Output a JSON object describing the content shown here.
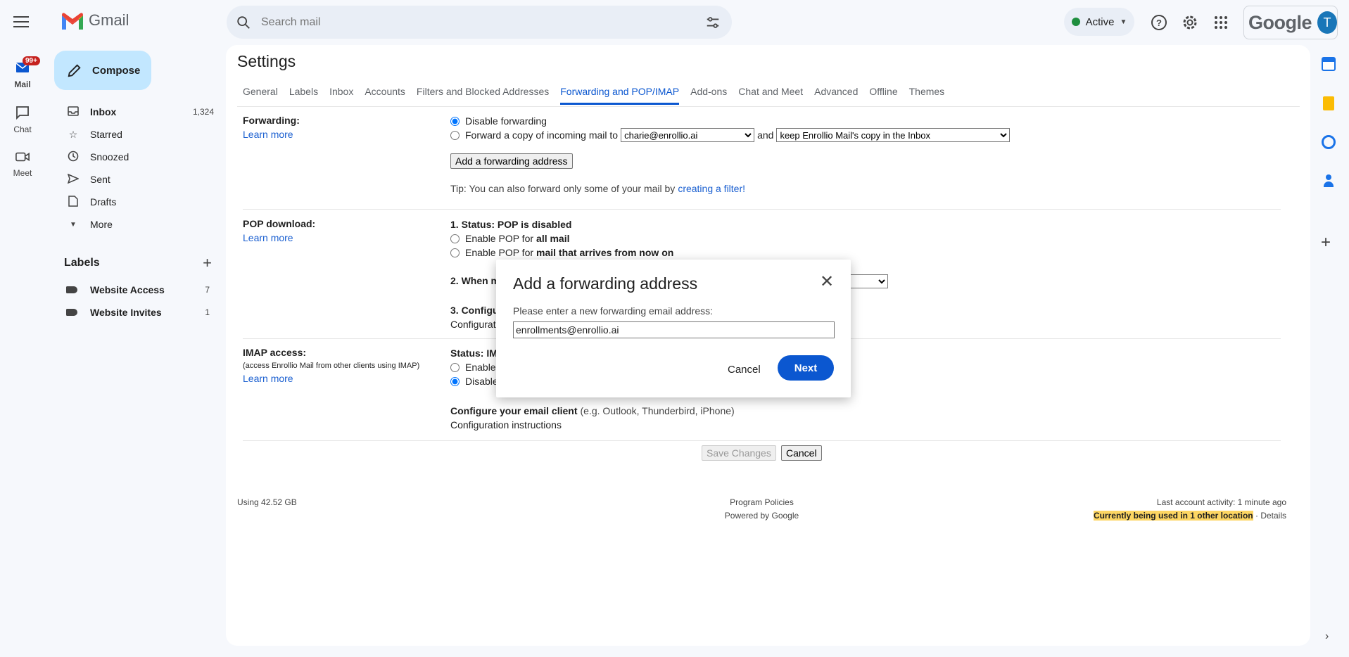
{
  "app": {
    "logo_text": "Gmail",
    "google_text": "Google",
    "avatar_letter": "T"
  },
  "search": {
    "placeholder": "Search mail"
  },
  "header": {
    "status_label": "Active"
  },
  "rail": {
    "mail_badge": "99+",
    "items": [
      {
        "label": "Mail"
      },
      {
        "label": "Chat"
      },
      {
        "label": "Meet"
      }
    ]
  },
  "compose_label": "Compose",
  "nav": {
    "items": [
      {
        "label": "Inbox",
        "count": "1,324"
      },
      {
        "label": "Starred"
      },
      {
        "label": "Snoozed"
      },
      {
        "label": "Sent"
      },
      {
        "label": "Drafts"
      },
      {
        "label": "More"
      }
    ]
  },
  "labels": {
    "title": "Labels",
    "items": [
      {
        "label": "Website Access",
        "count": "7"
      },
      {
        "label": "Website Invites",
        "count": "1"
      }
    ]
  },
  "settings": {
    "title": "Settings",
    "tabs": [
      {
        "label": "General"
      },
      {
        "label": "Labels"
      },
      {
        "label": "Inbox"
      },
      {
        "label": "Accounts"
      },
      {
        "label": "Filters and Blocked Addresses"
      },
      {
        "label": "Forwarding and POP/IMAP"
      },
      {
        "label": "Add-ons"
      },
      {
        "label": "Chat and Meet"
      },
      {
        "label": "Advanced"
      },
      {
        "label": "Offline"
      },
      {
        "label": "Themes"
      }
    ],
    "forwarding": {
      "title": "Forwarding:",
      "learn_more": "Learn more",
      "disable": "Disable forwarding",
      "forward_copy": "Forward a copy of incoming mail to",
      "address_select": "charie@enrollio.ai",
      "and": "and",
      "keep_select": "keep Enrollio Mail's copy in the Inbox",
      "add_button": "Add a forwarding address",
      "tip_prefix": "Tip: You can also forward only some of your mail by",
      "tip_link": "creating a filter!"
    },
    "pop": {
      "title": "POP download:",
      "learn_more": "Learn more",
      "status": "1. Status: POP is disabled",
      "enable_all_prefix": "Enable POP for",
      "enable_all_bold": "all mail",
      "enable_now_prefix": "Enable POP for",
      "enable_now_bold": "mail that arrives from now on",
      "step2": "2. When m",
      "step3": "3. Configu",
      "config_link": "Configurati"
    },
    "imap": {
      "title": "IMAP access:",
      "subtitle": "(access Enrollio Mail from other clients using IMAP)",
      "learn_more": "Learn more",
      "status": "Status: IM",
      "enable": "Enable",
      "disable": "Disable",
      "configure_bold": "Configure your email client",
      "configure_rest": "(e.g. Outlook, Thunderbird, iPhone)",
      "config_link": "Configuration instructions"
    },
    "save_changes": "Save Changes",
    "cancel": "Cancel"
  },
  "footer": {
    "storage": "Using 42.52 GB",
    "policies": "Program Policies",
    "powered": "Powered by Google",
    "activity": "Last account activity: 1 minute ago",
    "location": "Currently being used in 1 other location",
    "details": "· Details"
  },
  "dialog": {
    "title": "Add a forwarding address",
    "prompt": "Please enter a new forwarding email address:",
    "value": "enrollments@enrollio.ai",
    "cancel": "Cancel",
    "next": "Next"
  }
}
